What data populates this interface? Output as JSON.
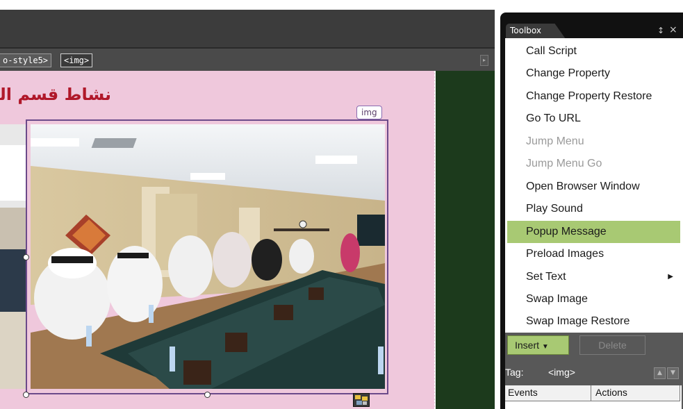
{
  "tag_selector": {
    "chips": [
      "o-style5>",
      "<img>"
    ]
  },
  "canvas": {
    "heading": "نشاط قسم الـ",
    "img_label": "img"
  },
  "toolbox": {
    "title": "Toolbox",
    "items": [
      {
        "label": "Call Script",
        "state": "normal"
      },
      {
        "label": "Change Property",
        "state": "normal"
      },
      {
        "label": "Change Property Restore",
        "state": "normal"
      },
      {
        "label": "Go To URL",
        "state": "normal"
      },
      {
        "label": "Jump Menu",
        "state": "disabled"
      },
      {
        "label": "Jump Menu Go",
        "state": "disabled"
      },
      {
        "label": "Open Browser Window",
        "state": "normal"
      },
      {
        "label": "Play Sound",
        "state": "normal"
      },
      {
        "label": "Popup Message",
        "state": "selected"
      },
      {
        "label": "Preload Images",
        "state": "normal"
      },
      {
        "label": "Set Text",
        "state": "submenu"
      },
      {
        "label": "Swap Image",
        "state": "normal"
      },
      {
        "label": "Swap Image Restore",
        "state": "normal"
      }
    ],
    "insert_label": "Insert",
    "delete_label": "Delete",
    "tag_label": "Tag:",
    "tag_value": "<img>",
    "columns": [
      "Events",
      "Actions"
    ]
  },
  "colors": {
    "canvas_bg": "#efc8dc",
    "heading": "#b0182a",
    "selected_item": "#a8c973"
  }
}
